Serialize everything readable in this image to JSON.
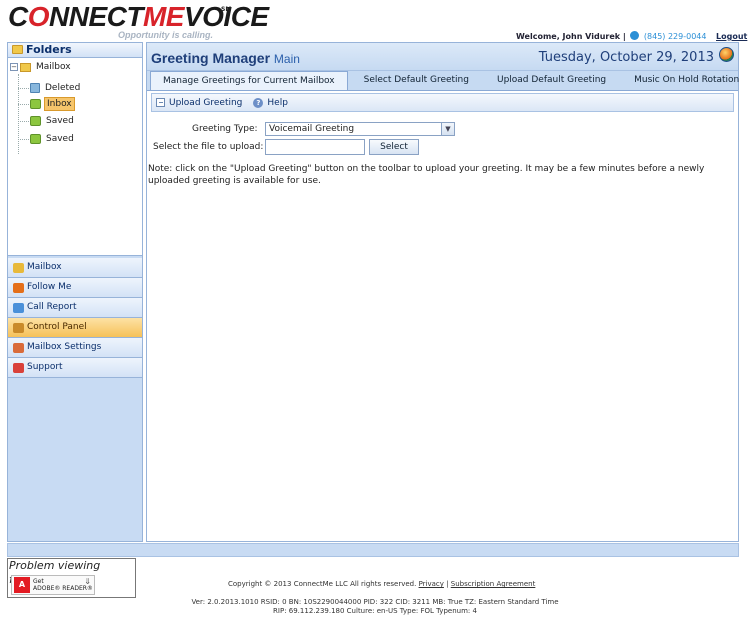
{
  "header": {
    "logo_part1": "C",
    "logo_part2": "NNECT",
    "logo_part3": "ME",
    "logo_part4": "VOICE",
    "logo_sm": "SM",
    "tagline": "Opportunity is calling.",
    "welcome_prefix": "Welcome, John Vidurek |",
    "phone": "(845) 229-0044",
    "logout": "Logout"
  },
  "sidebar": {
    "folders_title": "Folders",
    "tree": {
      "root": "Mailbox",
      "items": [
        "Deleted",
        "Inbox",
        "Saved",
        "Saved"
      ]
    },
    "nav": [
      {
        "label": "Mailbox",
        "icon": "mailbox-icon",
        "color": "#e8b93a"
      },
      {
        "label": "Follow Me",
        "icon": "follow-me-icon",
        "color": "#e46f1a"
      },
      {
        "label": "Call Report",
        "icon": "call-report-icon",
        "color": "#4a90d9"
      },
      {
        "label": "Control Panel",
        "icon": "control-panel-icon",
        "color": "#c98a2a"
      },
      {
        "label": "Mailbox Settings",
        "icon": "mailbox-settings-icon",
        "color": "#d96b3a"
      },
      {
        "label": "Support",
        "icon": "support-icon",
        "color": "#d9413a"
      }
    ],
    "active_nav": "Control Panel"
  },
  "main": {
    "title": "Greeting Manager",
    "title_sub": "Main",
    "date": "Tuesday, October 29, 2013",
    "tabs": [
      "Manage Greetings for Current Mailbox",
      "Select Default Greeting",
      "Upload Default Greeting",
      "Music On Hold Rotation"
    ],
    "toolbar": {
      "upload": "Upload Greeting",
      "help": "Help"
    },
    "form": {
      "greeting_type_label": "Greeting Type:",
      "greeting_type_value": "Voicemail Greeting",
      "file_label": "Select the file to upload:",
      "select_button": "Select",
      "note": "Note: click on the \"Upload Greeting\" button on the toolbar to upload your greeting. It may be a few minutes before a newly uploaded greeting is available for use."
    }
  },
  "footer": {
    "fax_title": "Problem viewing faxes?",
    "adobe_get": "Get",
    "adobe_reader": "ADOBE® READER®",
    "copyright": "Copyright © 2013 ConnectMe LLC All rights reserved.",
    "privacy": "Privacy",
    "sep": "|",
    "subscription": "Subscription Agreement",
    "version_line1": "Ver: 2.0.2013.1010   RSID: 0 BN: 10S2290044000 PID: 322 CID: 3211 MB: True   TZ: Eastern Standard Time",
    "version_line2": "RIP: 69.112.239.180 Culture: en-US Type: FOL Typenum: 4"
  }
}
